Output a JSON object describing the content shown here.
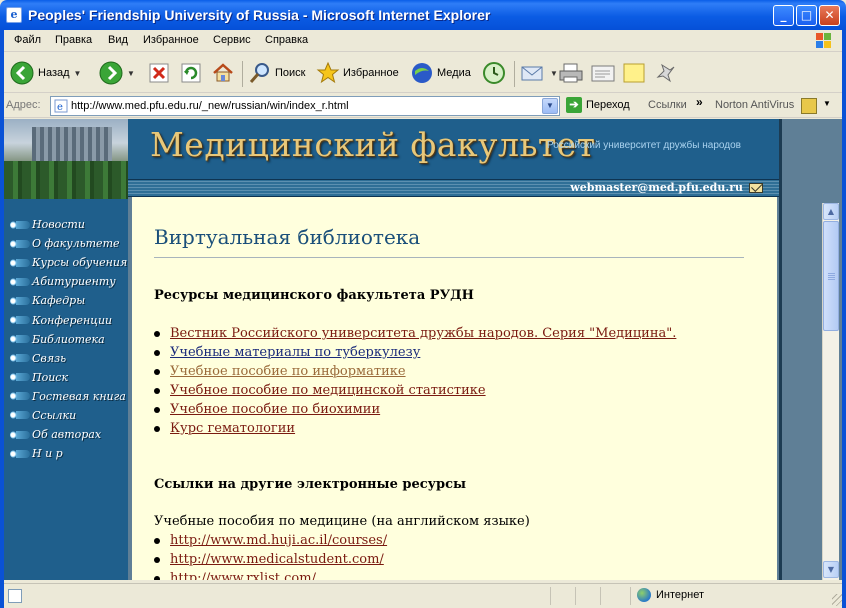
{
  "window": {
    "title": "Peoples' Friendship University of Russia - Microsoft Internet Explorer",
    "minimize": "_",
    "maximize": "□",
    "close": "✕"
  },
  "menu": [
    "Файл",
    "Правка",
    "Вид",
    "Избранное",
    "Сервис",
    "Справка"
  ],
  "toolbar": {
    "back": "Назад",
    "search": "Поиск",
    "favorites": "Избранное",
    "media": "Медиа"
  },
  "address": {
    "label": "Адрес:",
    "url": "http://www.med.pfu.edu.ru/_new/russian/win/index_r.html",
    "go": "Переход",
    "links": "Ссылки",
    "chevron": "»",
    "norton": "Norton AntiVirus"
  },
  "site": {
    "title": "Медицинский факультет",
    "subtitle": "Российский университет дружбы народов",
    "email": "webmaster@med.pfu.edu.ru"
  },
  "nav": [
    "Новости",
    "О факультете",
    "Курсы обучения",
    "Абитуриенту",
    "Кафедры",
    "Конференции",
    "Библиотека",
    "Связь",
    "Поиск",
    "Гостевая книга",
    "Ссылки",
    "Об авторах",
    "Н и р"
  ],
  "content": {
    "heading": "Виртуальная библиотека",
    "section1": "Ресурсы медицинского факультета РУДН",
    "resources": [
      "Вестник Российского университета дружбы народов. Серия \"Медицина\".",
      "Учебные материалы по туберкулезу",
      "Учебное пособие по информатике",
      "Учебное пособие по медицинской статистике",
      "Учебное пособие по биохимии",
      "Курс гематологии"
    ],
    "section2": "Ссылки на другие электронные ресурсы",
    "para": "Учебные пособия по медицине (на английском языке)",
    "links": [
      "http://www.md.huji.ac.il/courses/",
      "http://www.medicalstudent.com/",
      "http://www.rxlist.com/"
    ]
  },
  "status": {
    "zone": "Интернет"
  }
}
